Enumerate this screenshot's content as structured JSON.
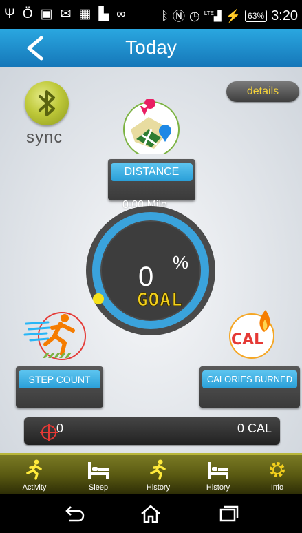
{
  "status_bar": {
    "battery": "63%",
    "time": "3:20",
    "network": "LTE"
  },
  "header": {
    "title": "Today"
  },
  "sync": {
    "label": "sync"
  },
  "details": {
    "label": "details"
  },
  "distance": {
    "label": "DISTANCE",
    "value": "0.00  Mile"
  },
  "goal": {
    "percent_value": "0",
    "percent_symbol": "%",
    "label": "GOAL",
    "progress": 0
  },
  "step_count": {
    "label": "STEP COUNT"
  },
  "calories": {
    "label": "CALORIES BURNED",
    "icon_text": "CAL"
  },
  "summary": {
    "steps": "0",
    "calories": "0 CAL"
  },
  "tabs": [
    {
      "label": "Activity",
      "icon": "runner-icon"
    },
    {
      "label": "Sleep",
      "icon": "bed-icon"
    },
    {
      "label": "History",
      "icon": "runner-icon"
    },
    {
      "label": "History",
      "icon": "bed-icon"
    },
    {
      "label": "Info",
      "icon": "gear-icon"
    }
  ],
  "colors": {
    "accent_blue": "#2aa7e0",
    "goal_yellow": "#f2cf1c",
    "tab_bar": "#6e6e1c"
  }
}
